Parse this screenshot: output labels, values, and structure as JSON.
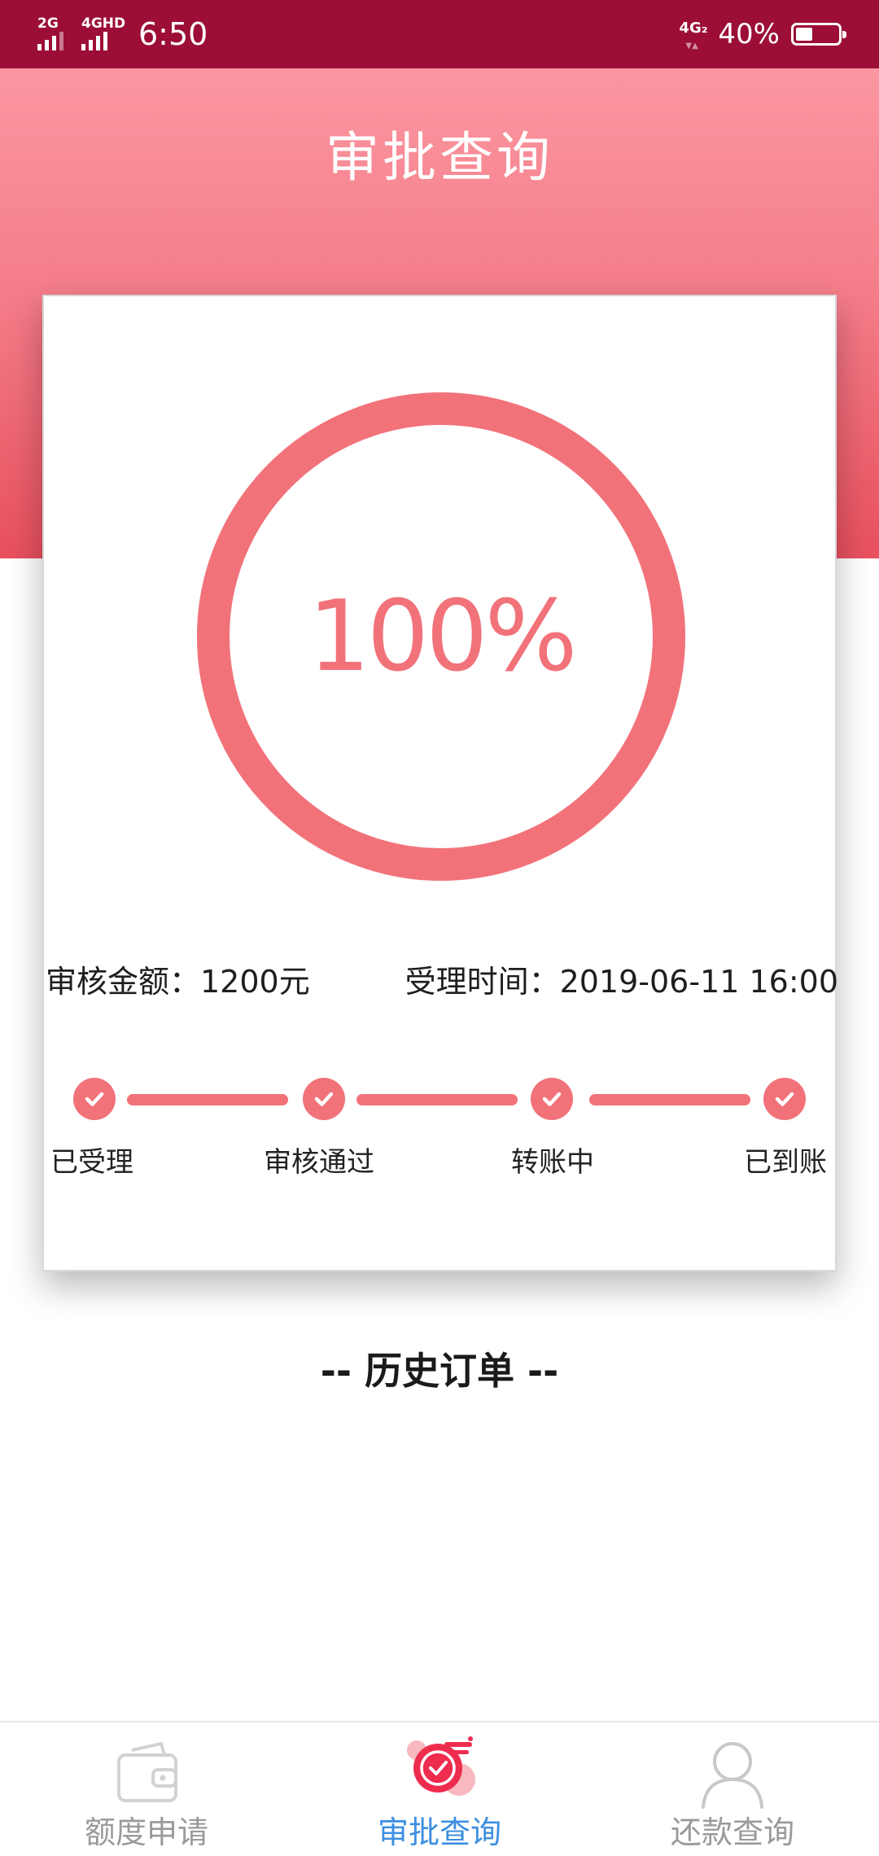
{
  "status_bar": {
    "network_1": "2G",
    "network_2": "4GHD",
    "time": "6:50",
    "network_right": "4G₂",
    "battery": "40%",
    "battery_level": 0.4,
    "icons": [
      "signal-icon",
      "signal-icon",
      "network-icon",
      "battery-icon"
    ]
  },
  "header": {
    "title": "审批查询"
  },
  "progress": {
    "percent_label": "100%",
    "percent_value": 100,
    "color": "#f2727a"
  },
  "details": {
    "amount": "审核金额：1200元",
    "time": "受理时间：2019-06-11 16:00"
  },
  "steps": [
    {
      "label": "已受理",
      "done": true,
      "icon": "check-icon"
    },
    {
      "label": "审核通过",
      "done": true,
      "icon": "check-icon"
    },
    {
      "label": "转账中",
      "done": true,
      "icon": "check-icon"
    },
    {
      "label": "已到账",
      "done": true,
      "icon": "check-icon"
    }
  ],
  "history": {
    "title": "-- 历史订单 --"
  },
  "tabbar": {
    "tabs": [
      {
        "label": "额度申请",
        "icon": "wallet-icon",
        "active": false
      },
      {
        "label": "审批查询",
        "icon": "approval-check-icon",
        "active": true
      },
      {
        "label": "还款查询",
        "icon": "user-icon",
        "active": false
      }
    ],
    "active_color": "#3d8fe0",
    "inactive_color": "#9a9a9a"
  },
  "colors": {
    "status_bar": "#9c0e36",
    "header_top": "#fb96a0",
    "header_bottom": "#e8505e",
    "accent": "#f2727a"
  }
}
